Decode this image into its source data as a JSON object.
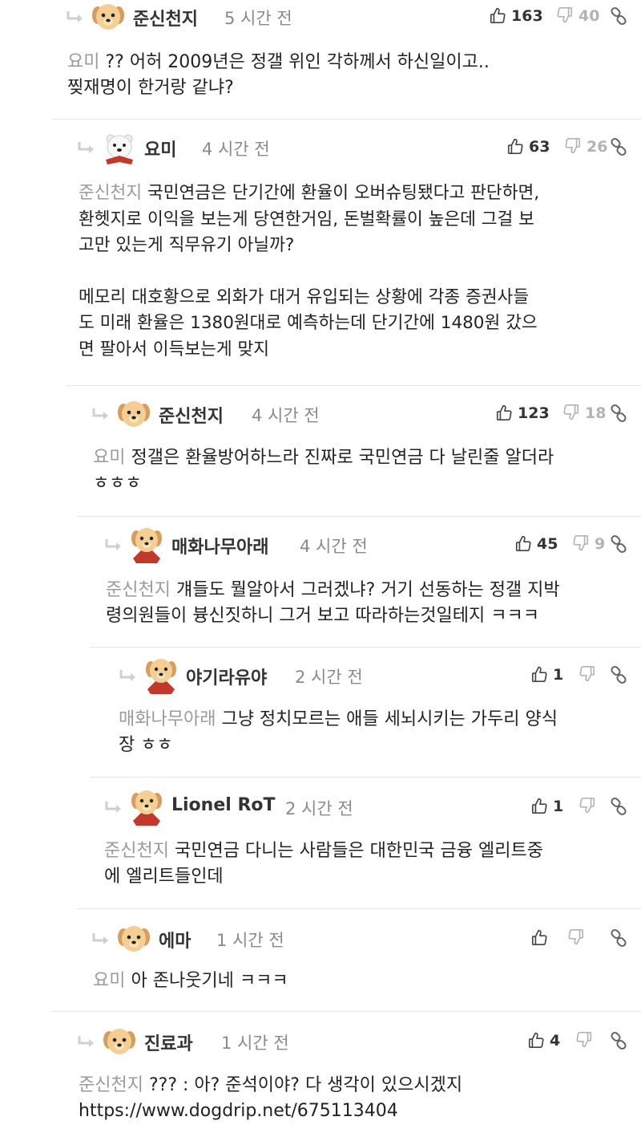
{
  "comments": [
    {
      "author": "준신천지",
      "time": "5 시간 전",
      "upvotes": "163",
      "downvotes": "40",
      "mention": "요미",
      "lines": [
        "?? 어허 2009년은 정갤 위인 각하께서 하신일이고..",
        "찢재명이 한거랑 같냐?"
      ]
    },
    {
      "author": "요미",
      "time": "4 시간 전",
      "upvotes": "63",
      "downvotes": "26",
      "mention": "준신천지",
      "lines": [
        "국민연금은 단기간에 환율이 오버슈팅됐다고 판단하면,",
        "환헷지로 이익을 보는게 당연한거임, 돈벌확률이 높은데 그걸 보",
        "고만 있는게 직무유기 아닐까?",
        "",
        "메모리 대호황으로 외화가 대거 유입되는 상황에 각종 증권사들",
        "도 미래 환율은 1380원대로 예측하는데 단기간에 1480원 갔으",
        "면 팔아서 이득보는게 맞지"
      ]
    },
    {
      "author": "준신천지",
      "time": "4 시간 전",
      "upvotes": "123",
      "downvotes": "18",
      "mention": "요미",
      "lines": [
        "정갤은 환율방어하느라 진짜로 국민연금 다 날린줄 알더라",
        "ㅎㅎㅎ"
      ]
    },
    {
      "author": "매화나무아래",
      "time": "4 시간 전",
      "upvotes": "45",
      "downvotes": "9",
      "mention": "준신천지",
      "lines": [
        "걔들도 뭘알아서 그러겠냐? 거기 선동하는 정갤 지박",
        "령의원들이 븅신짓하니 그거 보고 따라하는것일테지 ㅋㅋㅋ"
      ]
    },
    {
      "author": "야기라유야",
      "time": "2 시간 전",
      "upvotes": "1",
      "downvotes": "",
      "mention": "매화나무아래",
      "lines": [
        "그냥 정치모르는 애들 세뇌시키는 가두리 양식",
        "장 ㅎㅎ"
      ]
    },
    {
      "author": "Lionel RoT",
      "time": "2 시간 전",
      "upvotes": "1",
      "downvotes": "",
      "mention": "준신천지",
      "lines": [
        "국민연금 다니는 사람들은 대한민국 금융 엘리트중",
        "에 엘리트들인데"
      ]
    },
    {
      "author": "에마",
      "time": "1 시간 전",
      "upvotes": "",
      "downvotes": "",
      "mention": "요미",
      "lines": [
        "아 존나웃기네 ㅋㅋㅋ"
      ]
    },
    {
      "author": "진료과",
      "time": "1 시간 전",
      "upvotes": "4",
      "downvotes": "",
      "mention": "준신천지",
      "lines": [
        "??? : 아? 준석이야? 다 생각이 있으시겠지",
        "https://www.dogdrip.net/675113404"
      ]
    }
  ],
  "colors": {
    "text": "#222222",
    "muted": "#8a8a8a",
    "mention": "#9a9a9a",
    "icon": "#555555",
    "icon_light": "#b3b3b3",
    "border": "#e4e4e4"
  },
  "icons": [
    "reply-arrow-icon",
    "avatar-dog-icon",
    "avatar-polar-bear-icon",
    "avatar-dog-cape-icon",
    "thumbs-up-icon",
    "thumbs-down-icon",
    "link-icon"
  ]
}
